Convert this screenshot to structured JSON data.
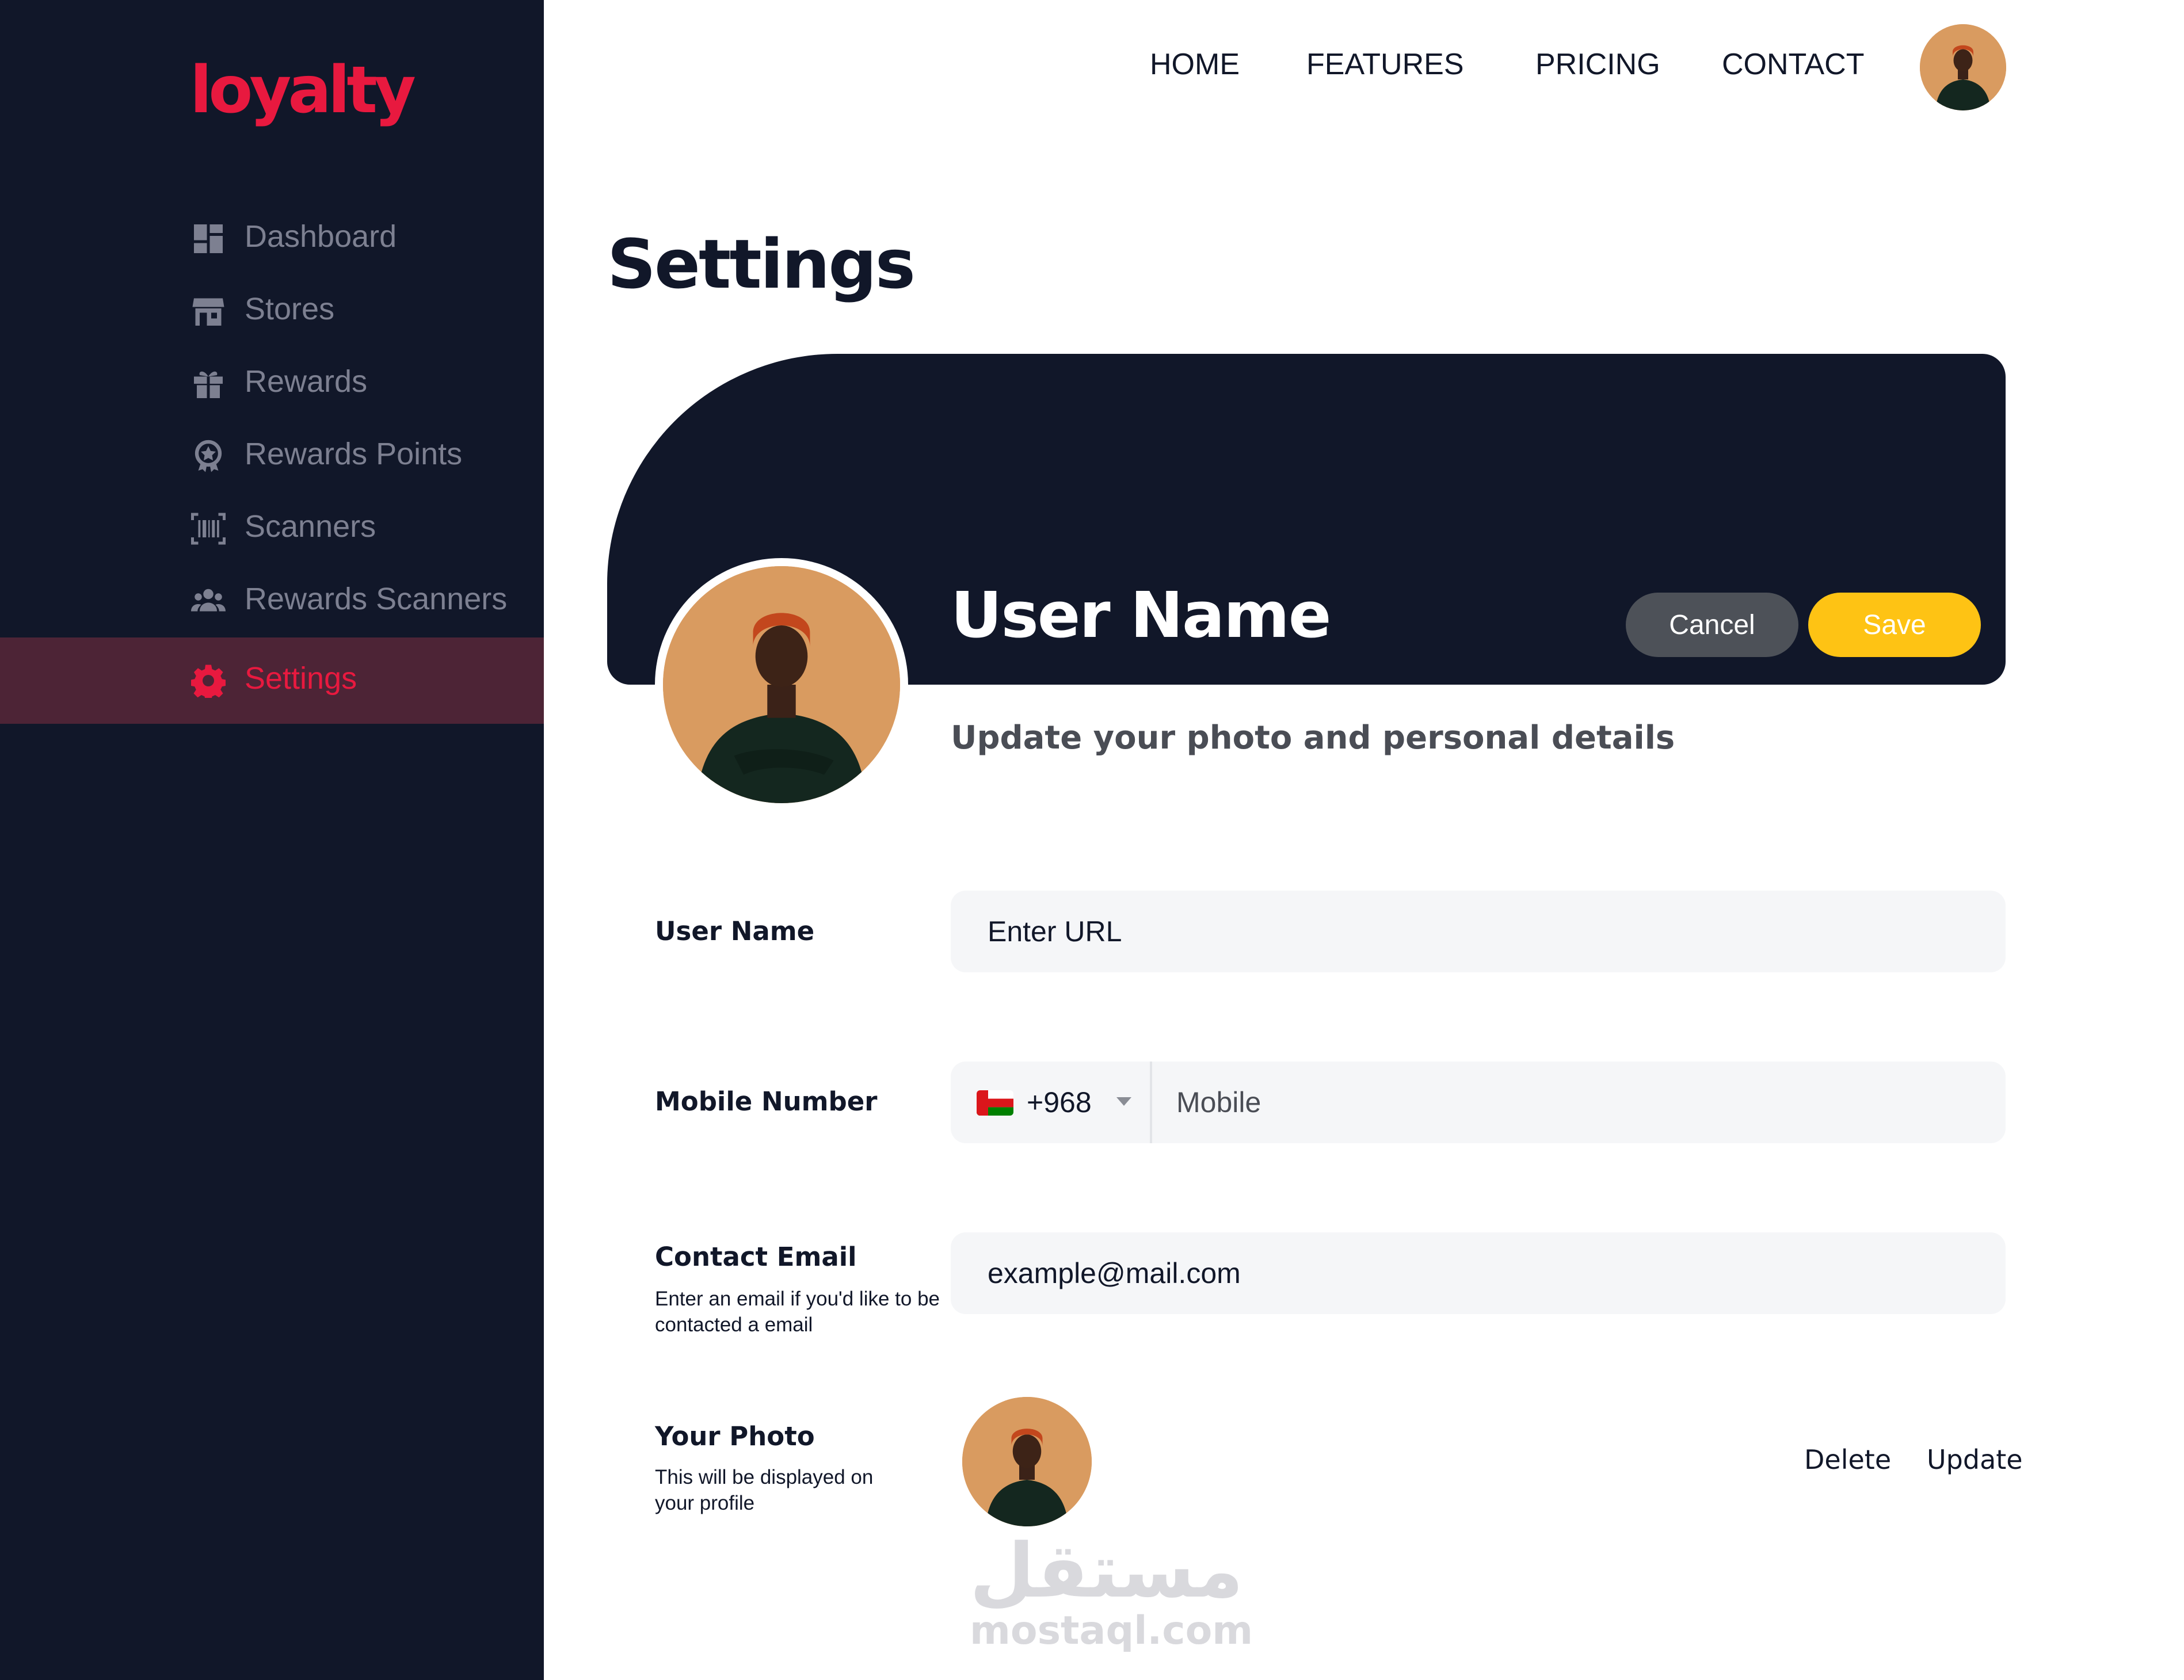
{
  "brand": {
    "logo": "loyalty",
    "accent_color": "#e8193f",
    "sidebar_bg": "#111729"
  },
  "sidebar": {
    "items": [
      {
        "label": "Dashboard",
        "icon": "dashboard-icon",
        "active": false
      },
      {
        "label": "Stores",
        "icon": "store-icon",
        "active": false
      },
      {
        "label": "Rewards",
        "icon": "gift-icon",
        "active": false
      },
      {
        "label": "Rewards Points",
        "icon": "badge-icon",
        "active": false
      },
      {
        "label": "Scanners",
        "icon": "barcode-icon",
        "active": false
      },
      {
        "label": "Rewards Scanners",
        "icon": "users-icon",
        "active": false
      },
      {
        "label": "Settings",
        "icon": "gear-icon",
        "active": true
      }
    ]
  },
  "topnav": {
    "links": [
      "HOME",
      "FEATURES",
      "PRICING",
      "CONTACT"
    ],
    "avatar_icon": "user-avatar"
  },
  "page": {
    "title": "Settings"
  },
  "profile": {
    "name": "User Name",
    "subtitle": "Update your photo and personal details",
    "cancel_label": "Cancel",
    "save_label": "Save",
    "save_color": "#fec314",
    "cancel_color": "#4d5158"
  },
  "form": {
    "username": {
      "label": "User Name",
      "placeholder": "Enter URL"
    },
    "mobile": {
      "label": "Mobile Number",
      "country_flag": "oman-flag-icon",
      "country_code": "+968",
      "placeholder": "Mobile"
    },
    "email": {
      "label": "Contact Email",
      "hint": "Enter an email if you'd like to be contacted a email",
      "value": "example@mail.com"
    },
    "photo": {
      "label": "Your Photo",
      "hint": "This will be displayed on your profile",
      "delete_label": "Delete",
      "update_label": "Update"
    }
  },
  "watermark": {
    "arabic": "مستقل",
    "latin": "mostaql.com"
  }
}
